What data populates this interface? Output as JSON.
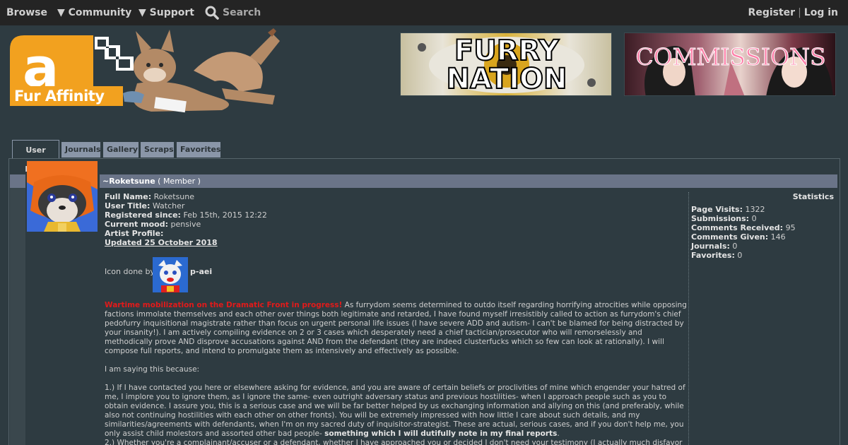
{
  "nav": {
    "browse": "Browse",
    "community": "▼ Community",
    "support": "▼ Support",
    "search": "Search",
    "register": "Register",
    "separator": "|",
    "login": "Log in"
  },
  "logo": {
    "text": "Fur Affinity"
  },
  "banners": [
    {
      "line1": "FURRY",
      "line2": "NATION"
    },
    {
      "line1": "COMMISSIONS"
    }
  ],
  "tabs": [
    "User Page",
    "Journals",
    "Gallery",
    "Scraps",
    "Favorites"
  ],
  "profile": {
    "username": "~Roketsune",
    "role": "( Member )",
    "fields": [
      {
        "label": "Full Name:",
        "value": "Roketsune"
      },
      {
        "label": "User Title:",
        "value": "Watcher"
      },
      {
        "label": "Registered since:",
        "value": "Feb 15th, 2015 12:22"
      },
      {
        "label": "Current mood:",
        "value": "pensive"
      },
      {
        "label": "Artist Profile:",
        "value": ""
      }
    ],
    "updated": "Updated 25 October 2018",
    "icon_credit_label": "Icon done by",
    "icon_credit_user": "p-aei"
  },
  "bio": {
    "headline": "Wartime mobilization on the Dramatic Front in progress!",
    "p1": " As furrydom seems determined to outdo itself regarding horrifying atrocities while opposing factions immolate themselves and each other over things both legitimate and retarded, I have found myself irresistibly called to action as furrydom's chief pedofurry inquisitional magistrate rather than focus on urgent personal life issues (I have severe ADD and autism- I can't be blamed for being distracted by your insanity!). I am actively compiling evidence on 2 or 3 cases which desperately need a chief tactician/prosecutor who will remorselessly and methodically prove AND disprove accusations against AND from the defendant (they are indeed clusterfucks which so few can look at rationally). I will compose full reports, and intend to promulgate them as intensively and effectively as possible.",
    "p2": "I am saying this because:",
    "p3a": "1.) If I have contacted you here or elsewhere asking for evidence, and you are aware of certain beliefs or proclivities of mine which engender your hatred of me, I implore you to ignore them, as I ignore the same- even outright adversary status and previous hostilities- when I approach people such as you to obtain evidence. I assure you, this is a serious case and we will be far better helped by us exchanging information and allying on this (and preferably, while also not continuing hostilities with each other on other fronts). You will be extremely impressed with how little I care about such details, and my similarities/agreements with defendants, when I'm on my sacred duty of inquisitor-strategist. These are actual, serious cases, and if you don't help me, you only assist child molestors and assorted other bad people- ",
    "p3b": "something which I will dutifully note in my final reports",
    "p3c": ".",
    "p4": "2.) Whether you're a complainant/accuser or a defendant, whether I have approached you or decided I don't need your testimony (I actually much disfavor this"
  },
  "stats": {
    "title": "Statistics",
    "items": [
      {
        "label": "Page Visits:",
        "value": "1322"
      },
      {
        "label": "Submissions:",
        "value": "0"
      },
      {
        "label": "Comments Received:",
        "value": "95"
      },
      {
        "label": "Comments Given:",
        "value": "146"
      },
      {
        "label": "Journals:",
        "value": "0"
      },
      {
        "label": "Favorites:",
        "value": "0"
      }
    ]
  },
  "colors": {
    "background": "#2e3b41",
    "nav": "#242424",
    "tab": "#8a96a8",
    "namebar": "#6a7488",
    "alert": "#e21a1a",
    "logo_orange": "#f0a020"
  }
}
